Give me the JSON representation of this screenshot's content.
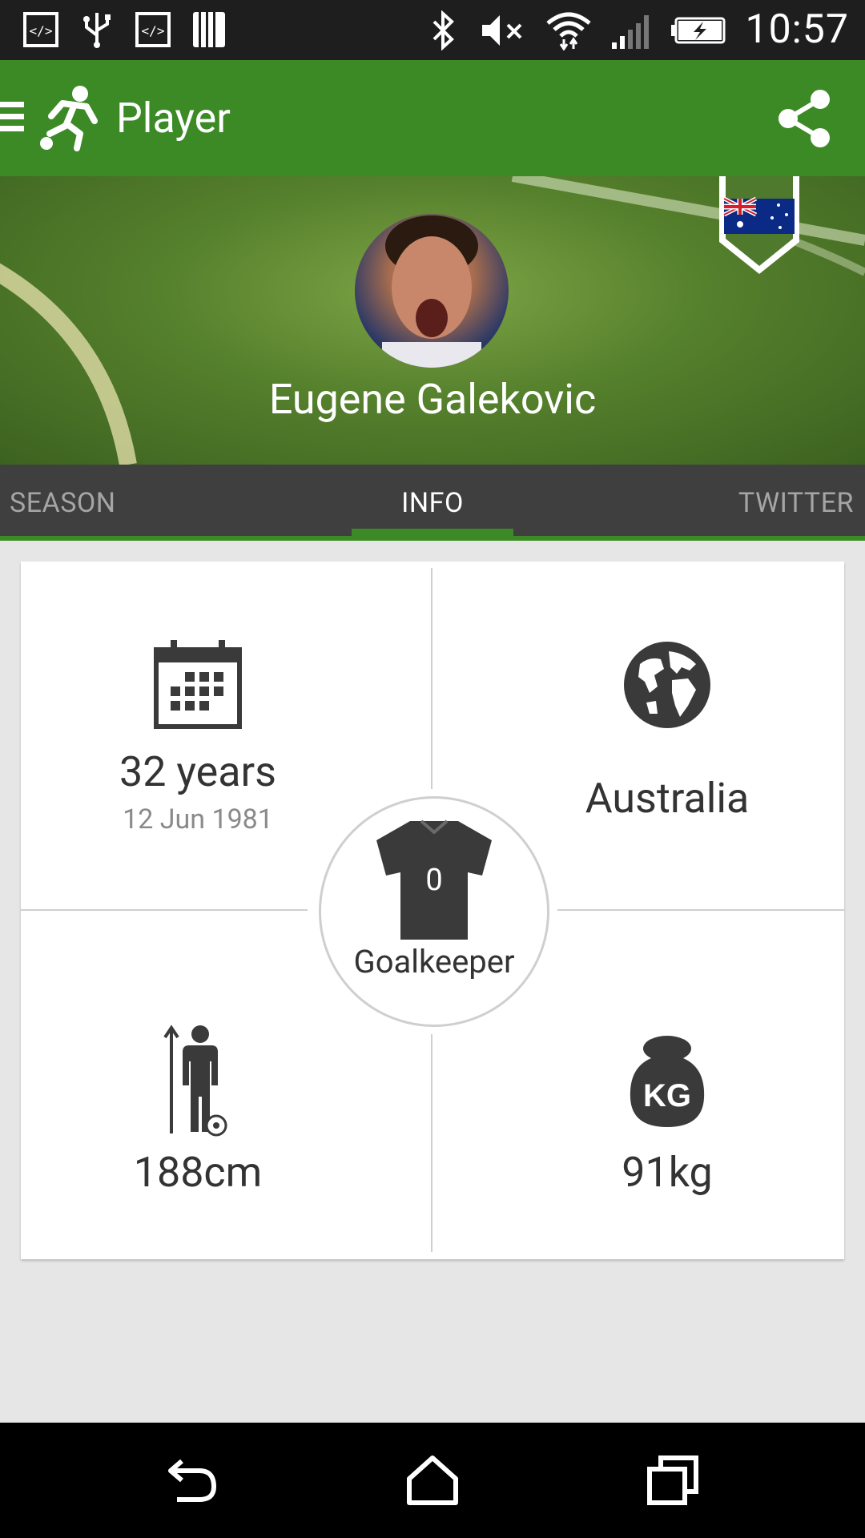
{
  "status_bar": {
    "time": "10:57"
  },
  "app_bar": {
    "title": "Player"
  },
  "player": {
    "name": "Eugene Galekovic",
    "country_flag": "australia-flag"
  },
  "tabs": [
    {
      "label": "SEASON",
      "selected": false
    },
    {
      "label": "INFO",
      "selected": true
    },
    {
      "label": "TWITTER",
      "selected": false
    }
  ],
  "info": {
    "age": "32 years",
    "birth_date": "12 Jun 1981",
    "nationality": "Australia",
    "shirt_number": "0",
    "position": "Goalkeeper",
    "height": "188cm",
    "weight": "91kg"
  },
  "colors": {
    "accent": "#3b8a25",
    "status_bar": "#1e1e1e",
    "tab_bar": "#3f3f3f",
    "icon_dark": "#3a3a3a"
  }
}
